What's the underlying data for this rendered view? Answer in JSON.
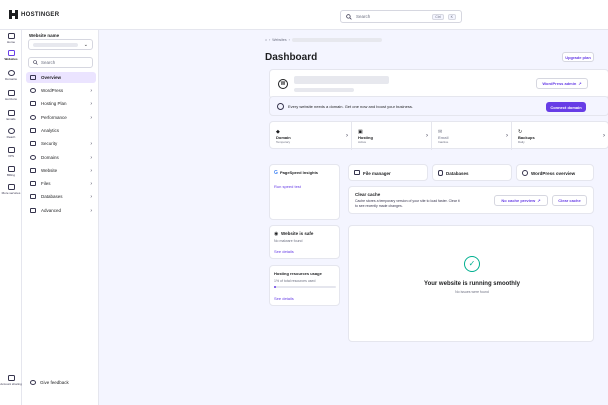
{
  "brand": {
    "name": "HOSTINGER"
  },
  "search": {
    "placeholder": "Search",
    "shortcut_ctrl": "Ctrl",
    "shortcut_key": "K"
  },
  "rail": [
    {
      "label": "Home",
      "icon": "home-icon"
    },
    {
      "label": "Websites",
      "icon": "websites-icon"
    },
    {
      "label": "Domains",
      "icon": "globe-icon"
    },
    {
      "label": "Horizons",
      "icon": "horizons-icon"
    },
    {
      "label": "Emails",
      "icon": "mail-icon"
    },
    {
      "label": "Reach",
      "icon": "reach-icon"
    },
    {
      "label": "VPS",
      "icon": "server-icon"
    },
    {
      "label": "Billing",
      "icon": "billing-icon"
    },
    {
      "label": "More services",
      "icon": "grid-icon"
    },
    {
      "label": "Account sharing",
      "icon": "users-icon"
    }
  ],
  "sidebar": {
    "title": "Website name",
    "search_placeholder": "Search",
    "items": [
      {
        "label": "Overview",
        "icon": "overview-icon"
      },
      {
        "label": "WordPress",
        "icon": "wordpress-icon"
      },
      {
        "label": "Hosting Plan",
        "icon": "hosting-icon"
      },
      {
        "label": "Performance",
        "icon": "gauge-icon"
      },
      {
        "label": "Analytics",
        "icon": "chart-icon"
      },
      {
        "label": "Security",
        "icon": "shield-icon"
      },
      {
        "label": "Domains",
        "icon": "globe-icon"
      },
      {
        "label": "Website",
        "icon": "window-icon"
      },
      {
        "label": "Files",
        "icon": "folder-icon"
      },
      {
        "label": "Databases",
        "icon": "database-icon"
      },
      {
        "label": "Advanced",
        "icon": "code-icon"
      }
    ],
    "feedback": "Give feedback"
  },
  "header": {
    "crumb_1": "Websites",
    "title": "Dashboard",
    "upgrade": "Upgrade plan"
  },
  "site_card": {
    "wp_admin": "WordPress admin"
  },
  "domain_banner": {
    "text": "Every website needs a domain. Get one now and boost your business.",
    "button": "Connect domain"
  },
  "quick": [
    {
      "title": "Domain",
      "sub": "Temporary"
    },
    {
      "title": "Hosting",
      "sub": "Active"
    },
    {
      "title": "Email",
      "sub": "Inactive"
    },
    {
      "title": "Backups",
      "sub": "Daily"
    }
  ],
  "pagespeed": {
    "title": "PageSpeed Insights",
    "link": "Run speed test"
  },
  "tools": {
    "file_manager": "File manager",
    "databases": "Databases",
    "wp_overview": "WordPress overview"
  },
  "cache": {
    "title": "Clear cache",
    "desc_1": "Cache stores a temporary version of your site to load faster. Clear it",
    "desc_2": "to see recently made changes.",
    "preview": "No cache preview",
    "clear": "Clear cache"
  },
  "safe": {
    "title": "Website is safe",
    "sub": "No malware found",
    "link": "See details"
  },
  "resources": {
    "title": "Hosting resources usage",
    "sub": "1% of total resources used",
    "usage_fraction": 0.01,
    "link": "See details"
  },
  "status": {
    "title": "Your website is running smoothly",
    "sub": "No issues were found"
  },
  "colors": {
    "accent": "#673de6",
    "success": "#00b090",
    "background": "#f4f5ff"
  }
}
